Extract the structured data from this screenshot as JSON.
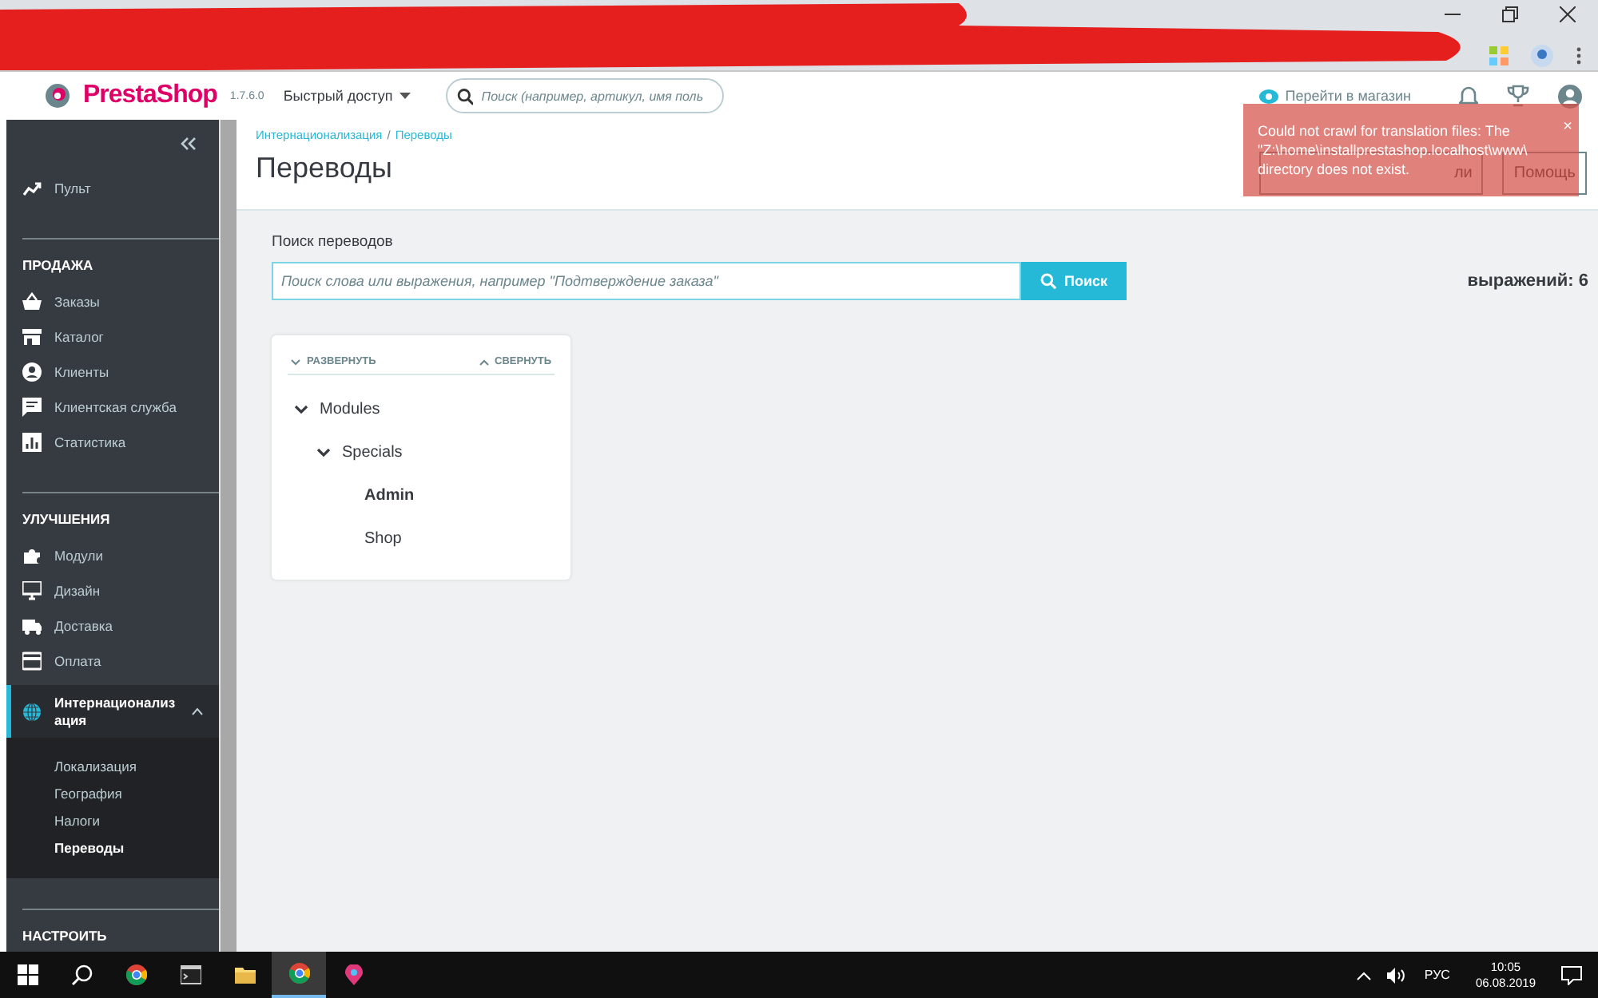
{
  "header": {
    "logo": "PrestaShop",
    "version": "1.7.6.0",
    "quick_access": "Быстрый доступ",
    "search": {
      "placeholder": "Поиск (например, артикул, имя поль"
    },
    "store_link": "Перейти в магазин"
  },
  "sidebar": {
    "items": [
      {
        "kind": "link",
        "label": "Пульт",
        "selected": false
      },
      {
        "kind": "heading",
        "label": "ПРОДАЖА"
      },
      {
        "kind": "link",
        "label": "Заказы",
        "selected": false
      },
      {
        "kind": "link",
        "label": "Каталог",
        "selected": false
      },
      {
        "kind": "link",
        "label": "Клиенты",
        "selected": false
      },
      {
        "kind": "link",
        "label": "Клиентская служба",
        "selected": false
      },
      {
        "kind": "link",
        "label": "Статистика",
        "selected": false
      },
      {
        "kind": "heading",
        "label": "УЛУЧШЕНИЯ"
      },
      {
        "kind": "link",
        "label": "Модули",
        "selected": false
      },
      {
        "kind": "link",
        "label": "Дизайн",
        "selected": false
      },
      {
        "kind": "link",
        "label": "Доставка",
        "selected": false
      },
      {
        "kind": "link",
        "label": "Оплата",
        "selected": false
      },
      {
        "kind": "link",
        "label": "Интернационализация",
        "selected": true,
        "expanded": true,
        "children": [
          {
            "label": "Локализация",
            "selected": false
          },
          {
            "label": "География",
            "selected": false
          },
          {
            "label": "Налоги",
            "selected": false
          },
          {
            "label": "Переводы",
            "selected": true
          }
        ]
      },
      {
        "kind": "heading",
        "label": "НАСТРОИТЬ"
      }
    ]
  },
  "page": {
    "breadcrumb": {
      "items": [
        "Интернационализация",
        "Переводы"
      ],
      "separator": "/"
    },
    "title": "Переводы",
    "toolbar_buttons": [
      "ли",
      "Помощь"
    ]
  },
  "toast": {
    "lines": [
      "Could not crawl for translation files: The",
      "\"Z:\\home\\installprestashop.localhost\\www\\",
      "directory does not exist."
    ],
    "close": "×"
  },
  "search": {
    "label": "Поиск переводов",
    "placeholder": "Поиск слова или выражения, например \"Подтверждение заказа\"",
    "button": "Поиск",
    "count": "выражений: 6"
  },
  "tree": {
    "expand": "РАЗВЕРНУТЬ",
    "collapse": "СВЕРНУТЬ",
    "nodes": [
      {
        "label": "Modules",
        "expanded": true,
        "selected": false,
        "children": [
          {
            "label": "Specials",
            "expanded": true,
            "selected": false,
            "children": [
              {
                "label": "Admin",
                "selected": true
              },
              {
                "label": "Shop",
                "selected": false
              }
            ]
          }
        ]
      }
    ]
  },
  "taskbar": {
    "apps": [
      {
        "kind": "start",
        "active": false
      },
      {
        "kind": "search",
        "active": false
      },
      {
        "kind": "chrome",
        "active": false
      },
      {
        "kind": "terminal",
        "active": false
      },
      {
        "kind": "folder",
        "active": false
      },
      {
        "kind": "chrome",
        "active": true
      },
      {
        "kind": "maps",
        "active": false
      }
    ],
    "language": "РУС",
    "time": "10:05",
    "date": "06.08.2019"
  }
}
